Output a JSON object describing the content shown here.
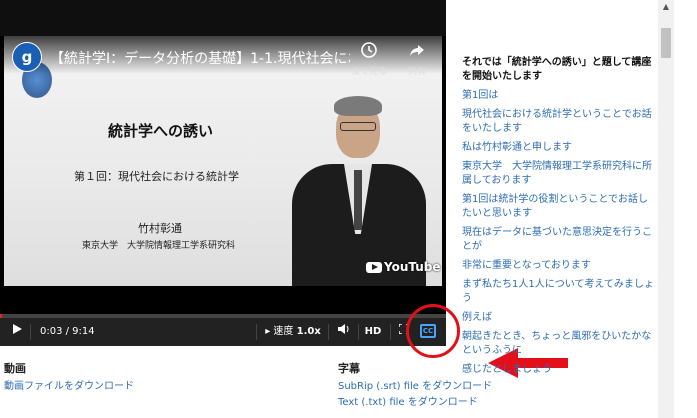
{
  "video": {
    "channel_initial": "g",
    "title": "【統計学Ⅰ：データ分析の基礎】1-1.現代社会におけ...",
    "watch_later_label": "後で見る",
    "share_label": "共有",
    "slide_title": "統計学への誘い",
    "slide_subtitle": "第１回：現代社会における統計学",
    "slide_name": "竹村彰通",
    "slide_affiliation": "東京大学　大学院情報理工学系研究科",
    "youtube_label": "YouTube",
    "progress_fraction": 0.005
  },
  "controls": {
    "time": "0:03 / 9:14",
    "speed_label": "速度",
    "speed_value": "1.0x",
    "hd_label": "HD",
    "cc_label": "CC"
  },
  "transcript": [
    "それでは「統計学への誘い」と題して講座を開始いたします",
    "第1回は",
    "現代社会における統計学ということでお話をいたします",
    "私は竹村彰通と申します",
    "東京大学　大学院情報理工学系研究科に所属しております",
    "第1回は統計学の役割ということでお話したいと思います",
    "現在はデータに基づいた意思決定を行うことが",
    "非常に重要となっております",
    "まず私たち1人1人について考えてみましょう",
    "例えば",
    "朝起きたとき、ちょっと風邪をひいたかなというふうに",
    "感じたとしましょう"
  ],
  "video_section": {
    "heading": "動画",
    "download_link": "動画ファイルをダウンロード"
  },
  "caption_section": {
    "heading": "字幕",
    "srt_link": "SubRip (.srt) file をダウンロード",
    "txt_link": "Text (.txt) file をダウンロード"
  },
  "colors": {
    "link": "#2d6db3",
    "annotation": "#e3101a",
    "progress": "#e02727"
  }
}
